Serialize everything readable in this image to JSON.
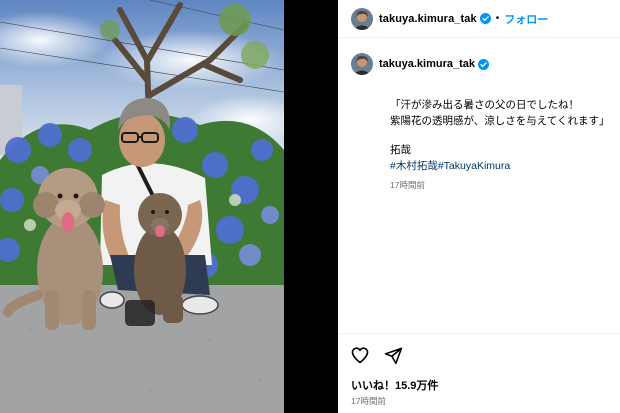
{
  "post": {
    "username": "takuya.kimura_tak",
    "separator": "•",
    "follow_label": "フォロー",
    "caption_lines": [
      "「汗が滲み出る暑さの父の日でしたね！",
      "紫陽花の透明感が、涼しさを与えてくれます」"
    ],
    "signature": "拓哉",
    "hashtags": [
      "#木村拓哉",
      "#TakuyaKimura"
    ],
    "caption_time": "17時間前",
    "likes": "いいね！15.9万件",
    "post_time": "17時間前"
  },
  "icons": {
    "verified": "verified-badge-icon",
    "like": "heart-icon",
    "share": "paper-plane-icon"
  },
  "colors": {
    "accent": "#0095f6",
    "hashtag": "#00376b",
    "muted": "#737373",
    "gutter": "#000000"
  }
}
